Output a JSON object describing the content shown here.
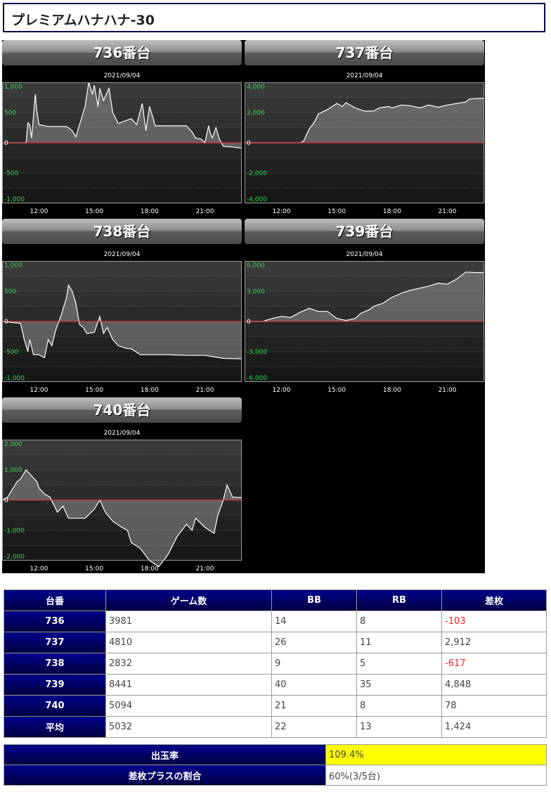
{
  "page": {
    "title": "プレミアムハナハナ-30"
  },
  "graphs": [
    {
      "header": "736番台",
      "date": "2021/09/04",
      "y_ticks": [
        "1,000",
        "500",
        "0",
        "-500",
        "-1,000"
      ],
      "x_ticks": [
        "12:00",
        "15:00",
        "18:00",
        "21:00"
      ]
    },
    {
      "header": "737番台",
      "date": "2021/09/04",
      "y_ticks": [
        "4,000",
        "2,000",
        "0",
        "-2,000",
        "-4,000"
      ],
      "x_ticks": [
        "12:00",
        "15:00",
        "18:00",
        "21:00"
      ]
    },
    {
      "header": "738番台",
      "date": "2021/09/04",
      "y_ticks": [
        "1,000",
        "500",
        "0",
        "-500",
        "-1,000"
      ],
      "x_ticks": [
        "12:00",
        "15:00",
        "18:00",
        "21:00"
      ]
    },
    {
      "header": "739番台",
      "date": "2021/09/04",
      "y_ticks": [
        "6,000",
        "3,000",
        "0",
        "-3,000",
        "-6,000"
      ],
      "x_ticks": [
        "12:00",
        "15:00",
        "18:00",
        "21:00"
      ]
    },
    {
      "header": "740番台",
      "date": "2021/09/04",
      "y_ticks": [
        "2,000",
        "1,000",
        "0",
        "-1,000",
        "-2,000"
      ],
      "x_ticks": [
        "12:00",
        "15:00",
        "18:00",
        "21:00"
      ]
    }
  ],
  "chart_data": [
    {
      "type": "area",
      "x_unit": "hour",
      "xlim": [
        10,
        23
      ],
      "ylim": [
        -1000,
        1000
      ],
      "points": [
        [
          10,
          0
        ],
        [
          10.5,
          0
        ],
        [
          11.3,
          0
        ],
        [
          11.4,
          330
        ],
        [
          11.5,
          300
        ],
        [
          11.6,
          80
        ],
        [
          11.8,
          800
        ],
        [
          11.9,
          500
        ],
        [
          12,
          300
        ],
        [
          12.5,
          270
        ],
        [
          13,
          270
        ],
        [
          13.5,
          270
        ],
        [
          13.8,
          200
        ],
        [
          14,
          100
        ],
        [
          14.2,
          300
        ],
        [
          14.5,
          600
        ],
        [
          14.7,
          1000
        ],
        [
          14.9,
          800
        ],
        [
          15,
          950
        ],
        [
          15.2,
          600
        ],
        [
          15.3,
          900
        ],
        [
          15.5,
          700
        ],
        [
          15.8,
          900
        ],
        [
          16,
          500
        ],
        [
          16.3,
          320
        ],
        [
          17,
          400
        ],
        [
          17.3,
          300
        ],
        [
          17.6,
          650
        ],
        [
          17.8,
          200
        ],
        [
          18,
          600
        ],
        [
          18.2,
          400
        ],
        [
          18.3,
          280
        ],
        [
          19,
          280
        ],
        [
          19.5,
          280
        ],
        [
          20,
          280
        ],
        [
          20.3,
          180
        ],
        [
          20.5,
          80
        ],
        [
          20.8,
          60
        ],
        [
          21,
          0
        ],
        [
          21.2,
          280
        ],
        [
          21.3,
          150
        ],
        [
          21.4,
          80
        ],
        [
          21.6,
          250
        ],
        [
          21.8,
          50
        ],
        [
          22,
          -60
        ],
        [
          22.5,
          -70
        ],
        [
          23,
          -90
        ]
      ]
    },
    {
      "type": "area",
      "x_unit": "hour",
      "xlim": [
        10,
        23
      ],
      "ylim": [
        -4000,
        4000
      ],
      "points": [
        [
          10,
          0
        ],
        [
          11,
          0
        ],
        [
          12,
          0
        ],
        [
          13,
          0
        ],
        [
          13.2,
          100
        ],
        [
          13.5,
          900
        ],
        [
          13.8,
          1400
        ],
        [
          14,
          1900
        ],
        [
          14.5,
          2200
        ],
        [
          15,
          2600
        ],
        [
          15.3,
          2400
        ],
        [
          15.5,
          2650
        ],
        [
          16,
          2300
        ],
        [
          16.5,
          2100
        ],
        [
          17,
          2100
        ],
        [
          17.3,
          2300
        ],
        [
          17.8,
          2400
        ],
        [
          18,
          2300
        ],
        [
          18.5,
          2500
        ],
        [
          19,
          2450
        ],
        [
          19.5,
          2300
        ],
        [
          20,
          2500
        ],
        [
          20.5,
          2350
        ],
        [
          21,
          2500
        ],
        [
          21.5,
          2600
        ],
        [
          22,
          2700
        ],
        [
          22.2,
          2900
        ],
        [
          23,
          2950
        ]
      ]
    },
    {
      "type": "area",
      "x_unit": "hour",
      "xlim": [
        10,
        23
      ],
      "ylim": [
        -1000,
        1000
      ],
      "points": [
        [
          10,
          0
        ],
        [
          11,
          -30
        ],
        [
          11.2,
          -300
        ],
        [
          11.4,
          -500
        ],
        [
          11.5,
          -300
        ],
        [
          11.7,
          -550
        ],
        [
          12,
          -550
        ],
        [
          12.3,
          -600
        ],
        [
          12.5,
          -300
        ],
        [
          12.7,
          -400
        ],
        [
          12.9,
          -150
        ],
        [
          13.2,
          100
        ],
        [
          13.5,
          400
        ],
        [
          13.6,
          600
        ],
        [
          13.8,
          500
        ],
        [
          14,
          300
        ],
        [
          14.2,
          -50
        ],
        [
          14.4,
          -100
        ],
        [
          14.6,
          -200
        ],
        [
          15,
          -180
        ],
        [
          15.3,
          80
        ],
        [
          15.5,
          -200
        ],
        [
          15.7,
          -100
        ],
        [
          16,
          -300
        ],
        [
          16.3,
          -400
        ],
        [
          16.8,
          -450
        ],
        [
          17,
          -450
        ],
        [
          17.5,
          -550
        ],
        [
          18,
          -550
        ],
        [
          19,
          -550
        ],
        [
          20,
          -560
        ],
        [
          21,
          -560
        ],
        [
          22,
          -610
        ],
        [
          23,
          -617
        ]
      ]
    },
    {
      "type": "area",
      "x_unit": "hour",
      "xlim": [
        10,
        23
      ],
      "ylim": [
        -6000,
        6000
      ],
      "points": [
        [
          10,
          0
        ],
        [
          11,
          0
        ],
        [
          11.5,
          300
        ],
        [
          12,
          500
        ],
        [
          12.5,
          400
        ],
        [
          13,
          900
        ],
        [
          13.5,
          1300
        ],
        [
          14,
          1000
        ],
        [
          14.5,
          1000
        ],
        [
          15,
          300
        ],
        [
          15.5,
          100
        ],
        [
          16,
          300
        ],
        [
          16.3,
          800
        ],
        [
          16.8,
          1200
        ],
        [
          17,
          1500
        ],
        [
          17.5,
          1800
        ],
        [
          18,
          2400
        ],
        [
          18.5,
          2800
        ],
        [
          19,
          3100
        ],
        [
          19.5,
          3300
        ],
        [
          20,
          3500
        ],
        [
          20.5,
          3800
        ],
        [
          21,
          3700
        ],
        [
          21.5,
          4200
        ],
        [
          22,
          4900
        ],
        [
          22.5,
          4850
        ],
        [
          23,
          4848
        ]
      ]
    },
    {
      "type": "area",
      "x_unit": "hour",
      "xlim": [
        10,
        23
      ],
      "ylim": [
        -2000,
        2000
      ],
      "points": [
        [
          10,
          0
        ],
        [
          10.3,
          100
        ],
        [
          10.5,
          300
        ],
        [
          10.8,
          600
        ],
        [
          11,
          700
        ],
        [
          11.3,
          1000
        ],
        [
          11.6,
          800
        ],
        [
          11.9,
          600
        ],
        [
          12,
          400
        ],
        [
          12.3,
          200
        ],
        [
          12.6,
          100
        ],
        [
          13,
          -400
        ],
        [
          13.3,
          -200
        ],
        [
          13.6,
          -600
        ],
        [
          14,
          -600
        ],
        [
          14.5,
          -600
        ],
        [
          15,
          -300
        ],
        [
          15.3,
          0
        ],
        [
          15.6,
          -400
        ],
        [
          16,
          -700
        ],
        [
          16.5,
          -900
        ],
        [
          16.8,
          -1000
        ],
        [
          17,
          -1400
        ],
        [
          17.5,
          -1600
        ],
        [
          18,
          -2000
        ],
        [
          18.5,
          -2200
        ],
        [
          19,
          -1800
        ],
        [
          19.5,
          -1200
        ],
        [
          20,
          -800
        ],
        [
          20.3,
          -1000
        ],
        [
          20.5,
          -600
        ],
        [
          21,
          -900
        ],
        [
          21.5,
          -1100
        ],
        [
          21.7,
          -500
        ],
        [
          22,
          0
        ],
        [
          22.2,
          500
        ],
        [
          22.5,
          100
        ],
        [
          23,
          78
        ]
      ]
    }
  ],
  "table": {
    "headers": [
      "台番",
      "ゲーム数",
      "BB",
      "RB",
      "差枚"
    ],
    "rows": [
      {
        "label": "736",
        "games": "3981",
        "bb": "14",
        "rb": "8",
        "diff": "-103",
        "negative": true
      },
      {
        "label": "737",
        "games": "4810",
        "bb": "26",
        "rb": "11",
        "diff": "2,912",
        "negative": false
      },
      {
        "label": "738",
        "games": "2832",
        "bb": "9",
        "rb": "5",
        "diff": "-617",
        "negative": true
      },
      {
        "label": "739",
        "games": "8441",
        "bb": "40",
        "rb": "35",
        "diff": "4,848",
        "negative": false
      },
      {
        "label": "740",
        "games": "5094",
        "bb": "21",
        "rb": "8",
        "diff": "78",
        "negative": false
      },
      {
        "label": "平均",
        "games": "5032",
        "bb": "22",
        "rb": "13",
        "diff": "1,424",
        "negative": false
      }
    ]
  },
  "summary": {
    "payout_label": "出玉率",
    "payout_value": "109.4%",
    "plus_label": "差枚プラスの割合",
    "plus_value": "60%(3/5台)"
  }
}
